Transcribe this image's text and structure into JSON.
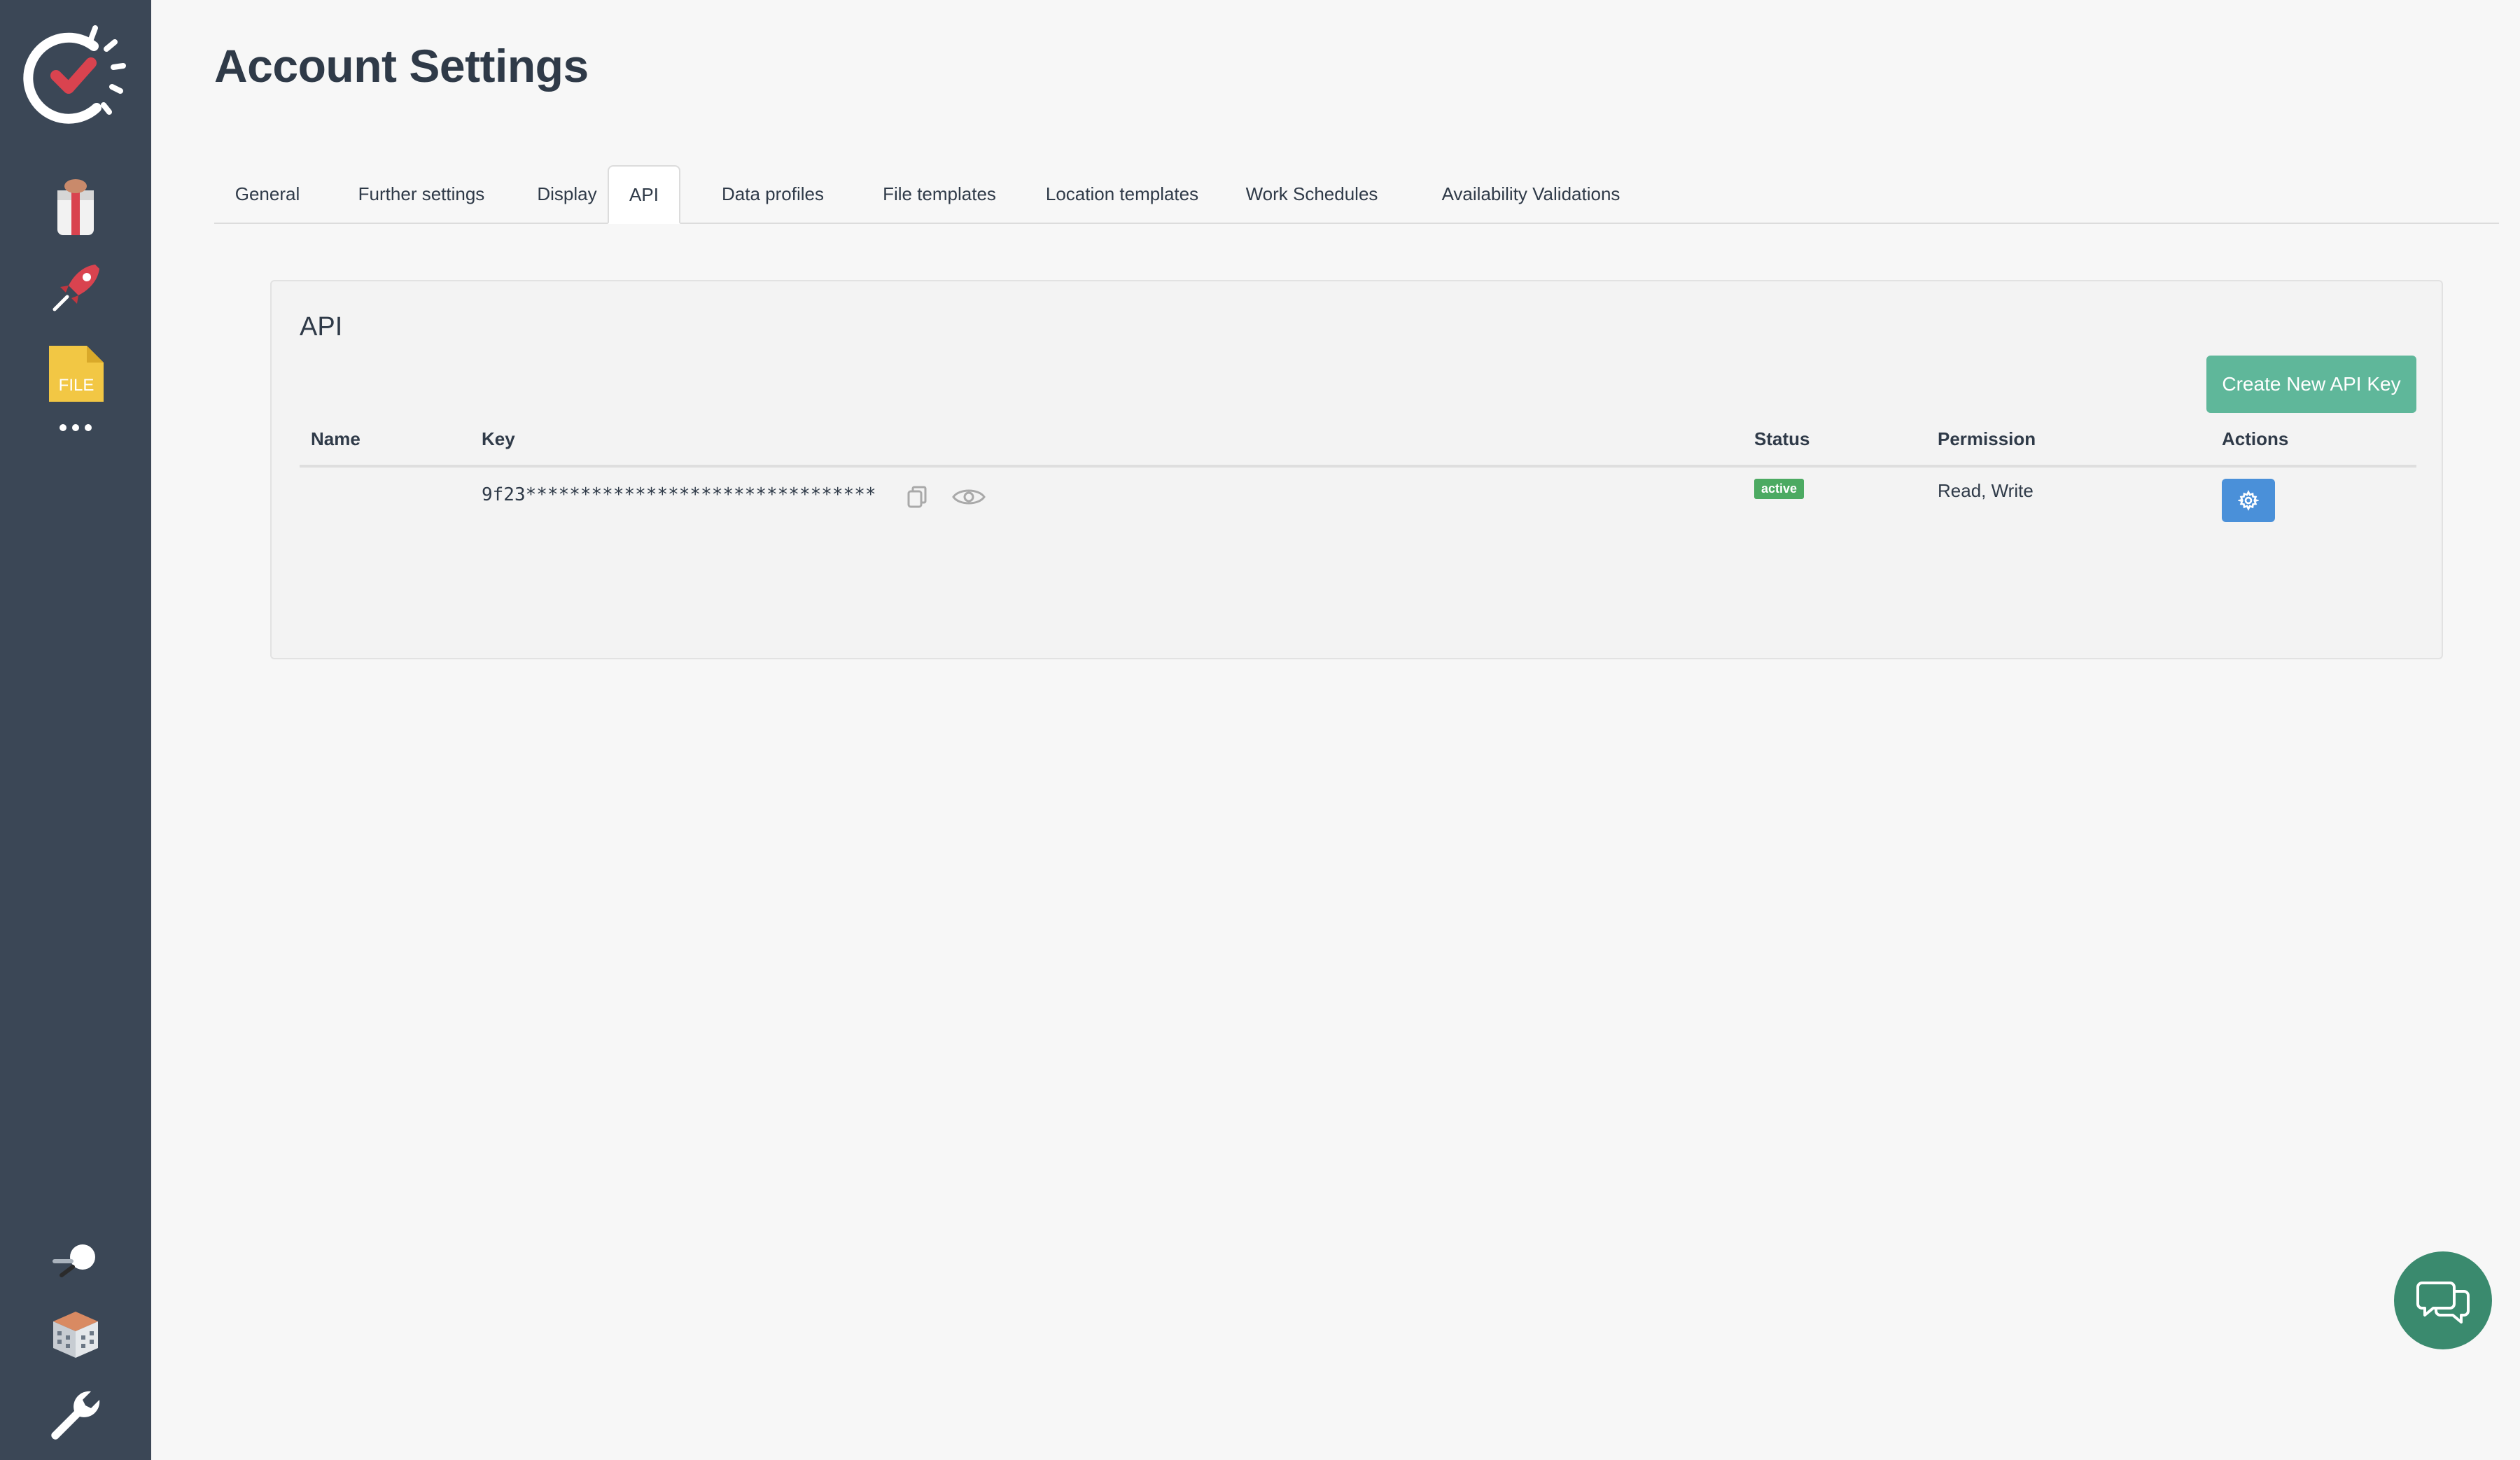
{
  "page": {
    "title": "Account Settings"
  },
  "sidebar": {
    "items": [
      {
        "icon": "logo-icon"
      },
      {
        "icon": "gift-icon"
      },
      {
        "icon": "rocket-icon"
      },
      {
        "icon": "file-icon",
        "label": "FILE"
      },
      {
        "icon": "more-icon"
      },
      {
        "icon": "search-icon"
      },
      {
        "icon": "building-icon"
      },
      {
        "icon": "wrench-icon"
      }
    ]
  },
  "tabs": [
    {
      "label": "General",
      "active": false
    },
    {
      "label": "Further settings",
      "active": false
    },
    {
      "label": "Display",
      "active": false
    },
    {
      "label": "API",
      "active": true
    },
    {
      "label": "Data profiles",
      "active": false
    },
    {
      "label": "File templates",
      "active": false
    },
    {
      "label": "Location templates",
      "active": false
    },
    {
      "label": "Work Schedules",
      "active": false
    },
    {
      "label": "Availability Validations",
      "active": false
    }
  ],
  "api_panel": {
    "title": "API",
    "create_button_label": "Create New API Key",
    "columns": {
      "name": "Name",
      "key": "Key",
      "status": "Status",
      "permission": "Permission",
      "actions": "Actions"
    },
    "rows": [
      {
        "name": "",
        "key": "9f23********************************",
        "status": "active",
        "permission": "Read, Write"
      }
    ]
  },
  "colors": {
    "sidebar_bg": "#3b4756",
    "accent_green": "#5fb79a",
    "status_green": "#4caa62",
    "action_blue": "#4a90d9",
    "chat_bg": "#3a8a6e"
  }
}
